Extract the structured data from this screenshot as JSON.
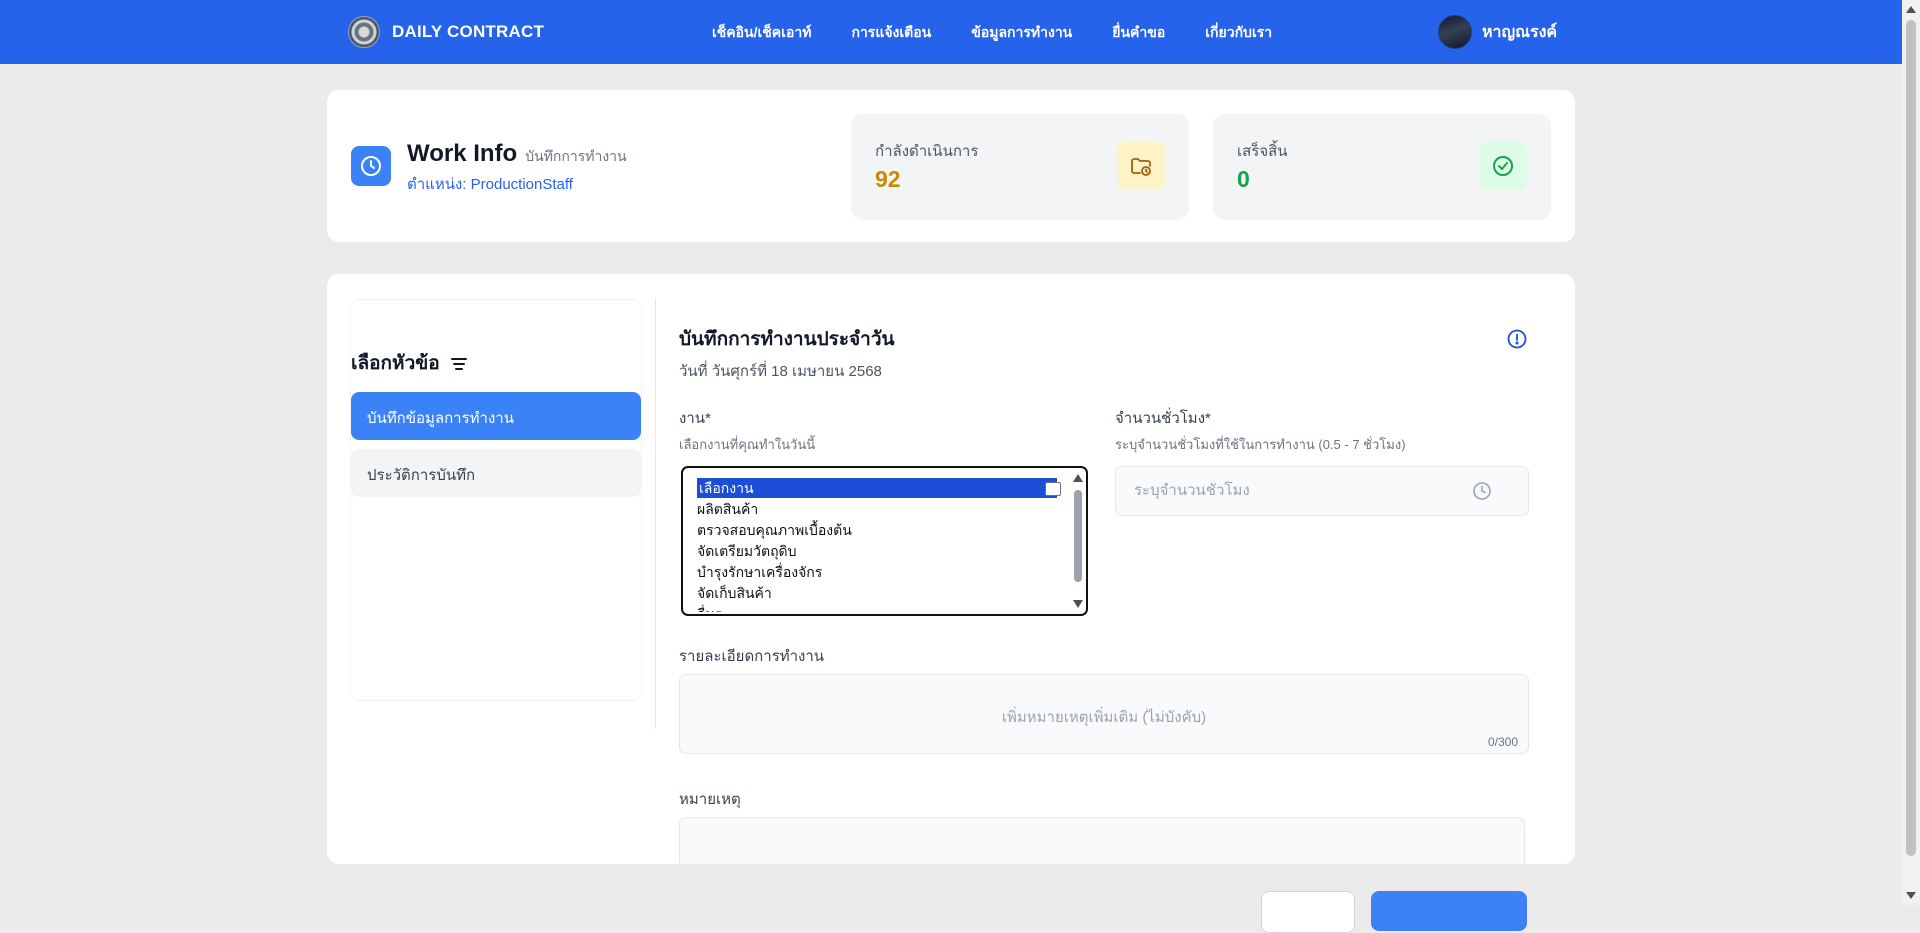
{
  "nav": {
    "brand": "DAILY CONTRACT",
    "links": [
      "เช็คอิน/เช็คเอาท์",
      "การแจ้งเตือน",
      "ข้อมูลการทำงาน",
      "ยื่นคำขอ",
      "เกี่ยวกับเรา"
    ],
    "user_name": "หาญณรงค์"
  },
  "header": {
    "title": "Work Info",
    "subtitle": "บันทึกการทำงาน",
    "position": "ตำแหน่ง: ProductionStaff"
  },
  "stats": {
    "in_progress": {
      "label": "กำลังดำเนินการ",
      "value": "92",
      "color": "#ca8a04",
      "icon": "folder-clock-icon",
      "icon_bg": "#fef3c7"
    },
    "completed": {
      "label": "เสร็จสิ้น",
      "value": "0",
      "color": "#16a34a",
      "icon": "check-circle-icon",
      "icon_bg": "#dcfce7"
    }
  },
  "sidebar": {
    "title": "เลือกหัวข้อ",
    "items": [
      {
        "label": "บันทึกข้อมูลการทำงาน",
        "active": true
      },
      {
        "label": "ประวัติการบันทึก",
        "active": false
      }
    ]
  },
  "form": {
    "title": "บันทึกการทำงานประจำวัน",
    "date": "วันที่ วันศุกร์ที่ 18 เมษายน 2568",
    "job": {
      "label": "งาน*",
      "help": "เลือกงานที่คุณทำในวันนี้",
      "options": [
        "เลือกงาน",
        "ผลิตสินค้า",
        "ตรวจสอบคุณภาพเบื้องต้น",
        "จัดเตรียมวัตถุดิบ",
        "บำรุงรักษาเครื่องจักร",
        "จัดเก็บสินค้า",
        "อื่นๆ"
      ],
      "selected": "เลือกงาน"
    },
    "hours": {
      "label": "จำนวนชั่วโมง*",
      "help": "ระบุจำนวนชั่วโมงที่ใช้ในการทำงาน (0.5 - 7 ชั่วโมง)",
      "placeholder": "ระบุจำนวนชั่วโมง"
    },
    "details": {
      "label": "รายละเอียดการทำงาน",
      "placeholder": "เพิ่มหมายเหตุเพิ่มเติม (ไม่บังคับ)",
      "counter": "0/300"
    },
    "note": {
      "label": "หมายเหตุ"
    }
  },
  "colors": {
    "primary": "#2563eb",
    "accent": "#3b82f6",
    "background": "#ebebeb"
  }
}
